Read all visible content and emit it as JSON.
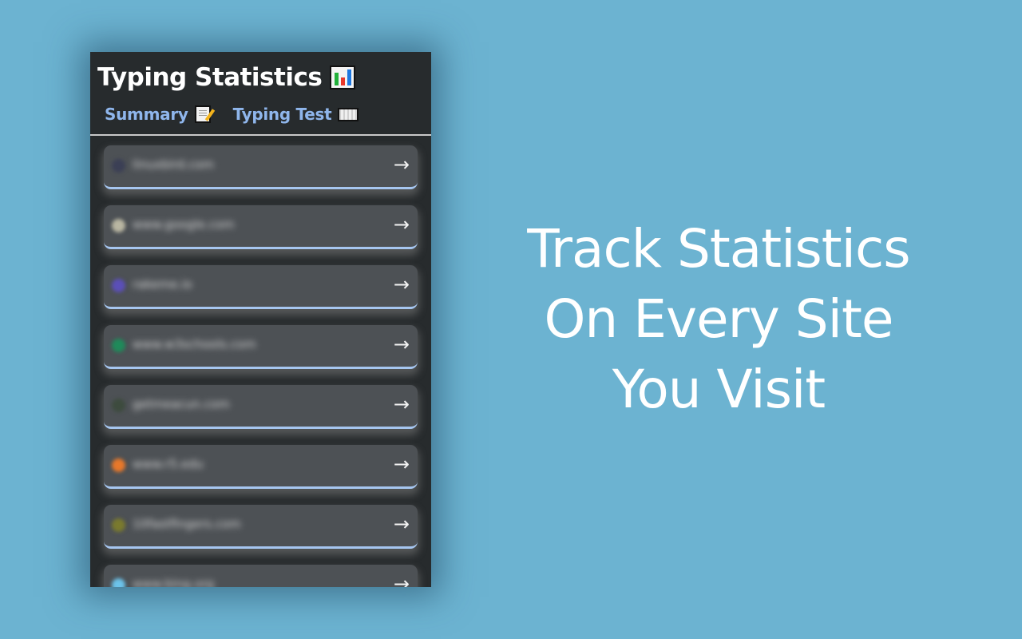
{
  "panel": {
    "title": "Typing Statistics",
    "title_icon": "bar-chart-icon",
    "tabs": [
      {
        "label": "Summary",
        "icon": "memo-icon"
      },
      {
        "label": "Typing Test",
        "icon": "keyboard-icon"
      }
    ],
    "sites": [
      {
        "name": "linuxbird.com",
        "favicon_color": "#3b3f55",
        "arrow": "→"
      },
      {
        "name": "www.google.com",
        "favicon_color": "#b9b6a2",
        "arrow": "→"
      },
      {
        "name": "rakeme.io",
        "favicon_color": "#5b4fb8",
        "arrow": "→"
      },
      {
        "name": "www.w3schools.com",
        "favicon_color": "#1f8a5a",
        "arrow": "→"
      },
      {
        "name": "getmeacun.com",
        "favicon_color": "#3d4b3e",
        "arrow": "→"
      },
      {
        "name": "www.r5.edu",
        "favicon_color": "#e8782a",
        "arrow": "→"
      },
      {
        "name": "10fastfingers.com",
        "favicon_color": "#7a7a2e",
        "arrow": "→"
      },
      {
        "name": "www.bing.org",
        "favicon_color": "#6cc3ea",
        "arrow": "→"
      }
    ]
  },
  "tagline": {
    "lines": [
      "Track Statistics",
      "On Every Site",
      "You Visit"
    ]
  },
  "colors": {
    "background": "#6cb3d1",
    "panel": "#272b2d",
    "card": "#4d5155",
    "accent": "#a6c6f0",
    "tab_text": "#8fb6ec"
  }
}
